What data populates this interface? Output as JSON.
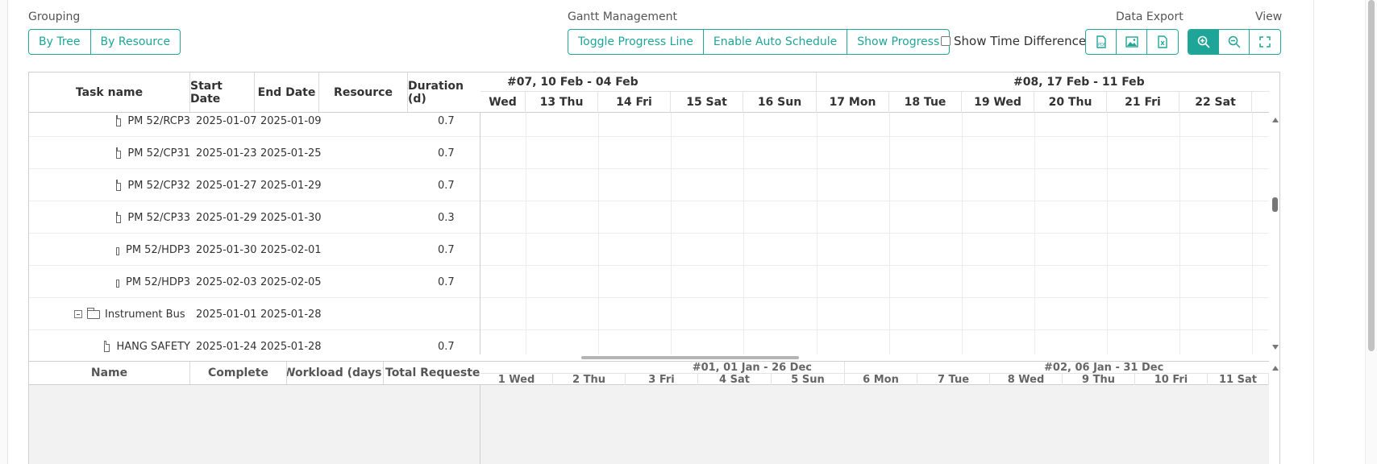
{
  "grouping": {
    "label": "Grouping",
    "buttons": [
      "By Tree",
      "By Resource"
    ]
  },
  "gantt_management": {
    "label": "Gantt Management",
    "buttons": [
      "Toggle Progress Line",
      "Enable Auto Schedule",
      "Show Progress"
    ]
  },
  "show_time_difference": {
    "label": "Show Time Difference",
    "checked": false
  },
  "data_export": {
    "label": "Data Export",
    "buttons": [
      "pdf-export-icon",
      "image-export-icon",
      "excel-export-icon"
    ]
  },
  "view": {
    "label": "View",
    "buttons": [
      "zoom-in-icon",
      "zoom-out-icon",
      "fullscreen-icon"
    ],
    "active": "zoom-in-icon"
  },
  "grid": {
    "columns": [
      "Task name",
      "Start Date",
      "End Date",
      "Resource",
      "Duration (d)"
    ],
    "rows": [
      {
        "type": "task",
        "name": "PM 52/RCP3",
        "start": "2025-01-07",
        "end": "2025-01-09",
        "resource": "",
        "duration": "0.7"
      },
      {
        "type": "task",
        "name": "PM 52/CP31",
        "start": "2025-01-23",
        "end": "2025-01-25",
        "resource": "",
        "duration": "0.7"
      },
      {
        "type": "task",
        "name": "PM 52/CP32",
        "start": "2025-01-27",
        "end": "2025-01-29",
        "resource": "",
        "duration": "0.7"
      },
      {
        "type": "task",
        "name": "PM 52/CP33",
        "start": "2025-01-29",
        "end": "2025-01-30",
        "resource": "",
        "duration": "0.3"
      },
      {
        "type": "task",
        "name": "PM 52/HDP3",
        "start": "2025-01-30",
        "end": "2025-02-01",
        "resource": "",
        "duration": "0.7"
      },
      {
        "type": "task",
        "name": "PM 52/HDP3",
        "start": "2025-02-03",
        "end": "2025-02-05",
        "resource": "",
        "duration": "0.7"
      },
      {
        "type": "group",
        "name": "Instrument Bus",
        "start": "2025-01-01",
        "end": "2025-01-28",
        "resource": "",
        "duration": ""
      },
      {
        "type": "task",
        "name": "HANG SAFETY",
        "start": "2025-01-24",
        "end": "2025-01-28",
        "resource": "",
        "duration": "0.7"
      }
    ]
  },
  "timeline": {
    "weeks": [
      "#07, 10 Feb - 04 Feb",
      "#08, 17 Feb - 11 Feb"
    ],
    "days": [
      "Wed",
      "13 Thu",
      "14 Fri",
      "15 Sat",
      "16 Sun",
      "17 Mon",
      "18 Tue",
      "19 Wed",
      "20 Thu",
      "21 Fri",
      "22 Sat"
    ]
  },
  "resources": {
    "columns": [
      "Name",
      "Complete",
      "Workload (days)",
      "Total Requested V"
    ],
    "weeks": [
      "#01, 01 Jan - 26 Dec",
      "#02, 06 Jan - 31 Dec"
    ],
    "days": [
      "1 Wed",
      "2 Thu",
      "3 Fri",
      "4 Sat",
      "5 Sun",
      "6 Mon",
      "7 Tue",
      "8 Wed",
      "9 Thu",
      "10 Fri",
      "11 Sat"
    ]
  }
}
